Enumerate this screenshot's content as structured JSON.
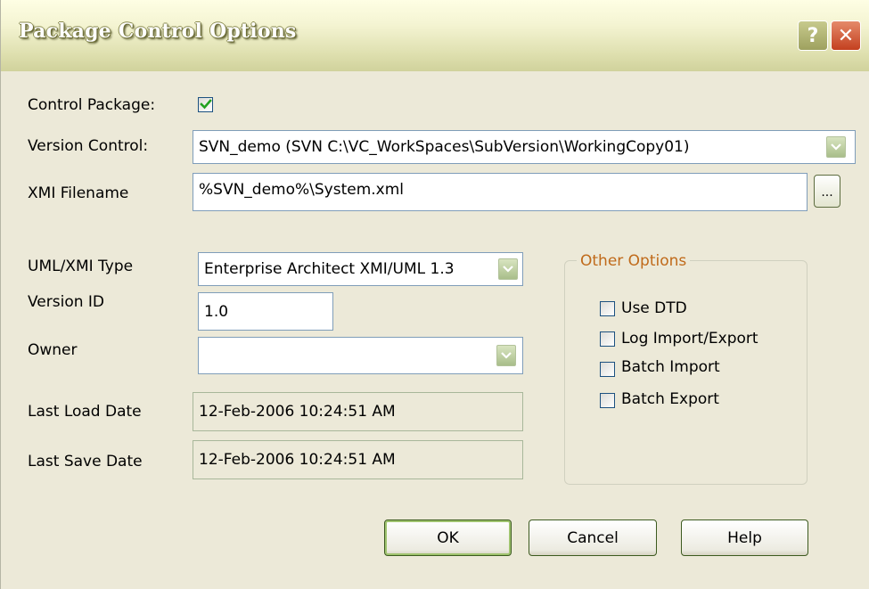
{
  "window": {
    "title": "Package Control Options",
    "help_glyph": "?",
    "close_glyph": "✕"
  },
  "control_package": {
    "label": "Control Package:",
    "checked": true
  },
  "version_control": {
    "label": "Version Control:",
    "value": "SVN_demo (SVN C:\\VC_WorkSpaces\\SubVersion\\WorkingCopy01)"
  },
  "xmi_filename": {
    "label": "XMI Filename",
    "value": "%SVN_demo%\\System.xml",
    "browse_label": "..."
  },
  "uml_xmi_type": {
    "label": "UML/XMI Type",
    "value": "Enterprise Architect XMI/UML 1.3"
  },
  "version_id": {
    "label": "Version ID",
    "value": "1.0"
  },
  "owner": {
    "label": "Owner",
    "value": ""
  },
  "last_load_date": {
    "label": "Last Load Date",
    "value": "12-Feb-2006 10:24:51 AM"
  },
  "last_save_date": {
    "label": "Last Save Date",
    "value": "12-Feb-2006 10:24:51 AM"
  },
  "other_options": {
    "title": "Other Options",
    "items": [
      {
        "label": "Use DTD",
        "checked": false
      },
      {
        "label": "Log Import/Export",
        "checked": false
      },
      {
        "label": "Batch Import",
        "checked": false
      },
      {
        "label": "Batch Export",
        "checked": false
      }
    ]
  },
  "buttons": {
    "ok": "OK",
    "cancel": "Cancel",
    "help": "Help"
  },
  "colors": {
    "accent_check": "#21a121",
    "group_title": "#c06a1a",
    "field_border": "#7f9db9",
    "dialog_bg": "#ece9d8"
  }
}
